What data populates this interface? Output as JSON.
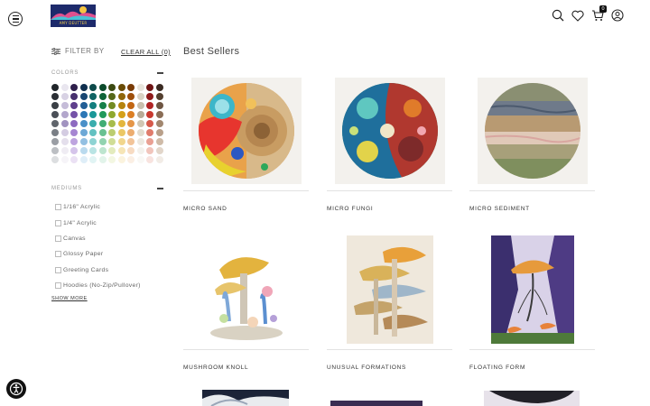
{
  "header": {
    "logo_text": "AMY DEUTTER",
    "cart_count": "0",
    "icons": [
      "menu-icon",
      "search-icon",
      "heart-icon",
      "cart-icon",
      "account-icon"
    ]
  },
  "filters": {
    "filter_by_label": "FILTER BY",
    "clear_all_label": "CLEAR ALL (0)",
    "colors_heading": "COLORS",
    "mediums_heading": "MEDIUMS",
    "mediums": [
      "1/16\" Acrylic",
      "1/4\" Acrylic",
      "Canvas",
      "Glossy Paper",
      "Greeting Cards",
      "Hoodies (No-Zip/Pullover)"
    ],
    "show_more_label": "SHOW MORE"
  },
  "colors": {
    "columns": [
      [
        "#20252a",
        "#2b2f35",
        "#3a3f45",
        "#4b5058",
        "#60656c",
        "#7a7f86",
        "#9a9ea4",
        "#bcbfc3",
        "#dcdee0"
      ],
      [
        "#e9e6ef",
        "#d8d2e4",
        "#c5bcd8",
        "#b3a7cc",
        "#a193c0",
        "#d4cce2",
        "#e4dfec",
        "#efecf3",
        "#f6f4f8"
      ],
      [
        "#2e1f4b",
        "#47306e",
        "#5e3f8c",
        "#7553a8",
        "#8d6ac0",
        "#a686d2",
        "#bea4df",
        "#d5c4ea",
        "#ebe1f4"
      ],
      [
        "#0f2f4e",
        "#184672",
        "#215e95",
        "#2c77b5",
        "#4a90c8",
        "#6da8d6",
        "#93c0e2",
        "#badaee",
        "#dfeef8"
      ],
      [
        "#0d4a4a",
        "#106464",
        "#137e7e",
        "#1b9898",
        "#3aadad",
        "#63c1c1",
        "#8ed3d3",
        "#b9e4e4",
        "#e1f4f4"
      ],
      [
        "#0b4a2b",
        "#0f6438",
        "#168049",
        "#21995b",
        "#40ad74",
        "#68c192",
        "#92d3b0",
        "#bde5cf",
        "#e2f4ea"
      ],
      [
        "#3c4a12",
        "#56681a",
        "#728a22",
        "#8fa82f",
        "#a7bc4c",
        "#bccd70",
        "#d0dd96",
        "#e3ebbd",
        "#f3f7e2"
      ],
      [
        "#6a4b06",
        "#8f660a",
        "#b5830e",
        "#d4a019",
        "#e3b63e",
        "#ebc765",
        "#f1d68d",
        "#f6e5b6",
        "#fbf3de"
      ],
      [
        "#7a3b06",
        "#9e4f0b",
        "#c26612",
        "#dc7f24",
        "#e59648",
        "#ecad70",
        "#f2c499",
        "#f7dbc2",
        "#fbefe4"
      ],
      [
        "#e8e4dc",
        "#d9d2c4",
        "#c9bfad",
        "#b8ab96",
        "#d1c7b4",
        "#e2dccf",
        "#ece8e0",
        "#f3f1ec",
        "#f9f8f5"
      ],
      [
        "#6e1414",
        "#8f1b1b",
        "#b02424",
        "#c8392f",
        "#d65a4b",
        "#e07c6c",
        "#e9a093",
        "#f1c5bc",
        "#f8e3df"
      ],
      [
        "#3a2a22",
        "#54402f",
        "#6e5542",
        "#8a6d56",
        "#a2876f",
        "#b9a08a",
        "#cfbba8",
        "#e2d6ca",
        "#f2ece6"
      ]
    ]
  },
  "main": {
    "title": "Best Sellers",
    "products": [
      {
        "title": "MICRO SAND"
      },
      {
        "title": "MICRO FUNGI"
      },
      {
        "title": "MICRO SEDIMENT"
      },
      {
        "title": "MUSHROOM KNOLL"
      },
      {
        "title": "UNUSUAL FORMATIONS"
      },
      {
        "title": "FLOATING FORM"
      }
    ]
  }
}
